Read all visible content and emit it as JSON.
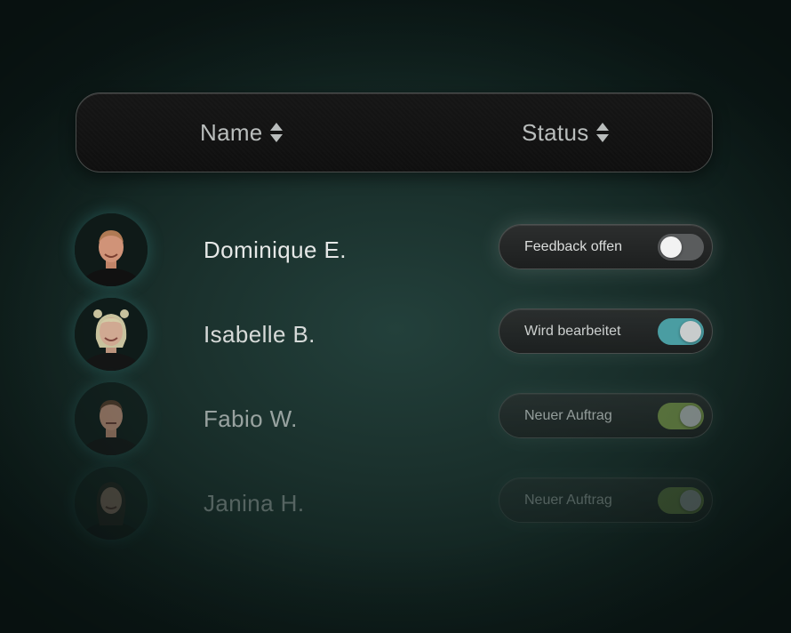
{
  "table": {
    "columns": [
      {
        "label": "Name",
        "sort_icon": "sort-updown-icon"
      },
      {
        "label": "Status",
        "sort_icon": "sort-updown-icon"
      }
    ],
    "rows": [
      {
        "name": "Dominique E.",
        "status": "Feedback offen",
        "toggle_on": false,
        "toggle_color": "#5a5c5d"
      },
      {
        "name": "Isabelle B.",
        "status": "Wird bearbeitet",
        "toggle_on": true,
        "toggle_color": "#4fa7ad"
      },
      {
        "name": "Fabio W.",
        "status": "Neuer Auftrag",
        "toggle_on": true,
        "toggle_color": "#7f9b4a"
      },
      {
        "name": "Janina H.",
        "status": "Neuer Auftrag",
        "toggle_on": true,
        "toggle_color": "#7f9b4a"
      }
    ]
  }
}
